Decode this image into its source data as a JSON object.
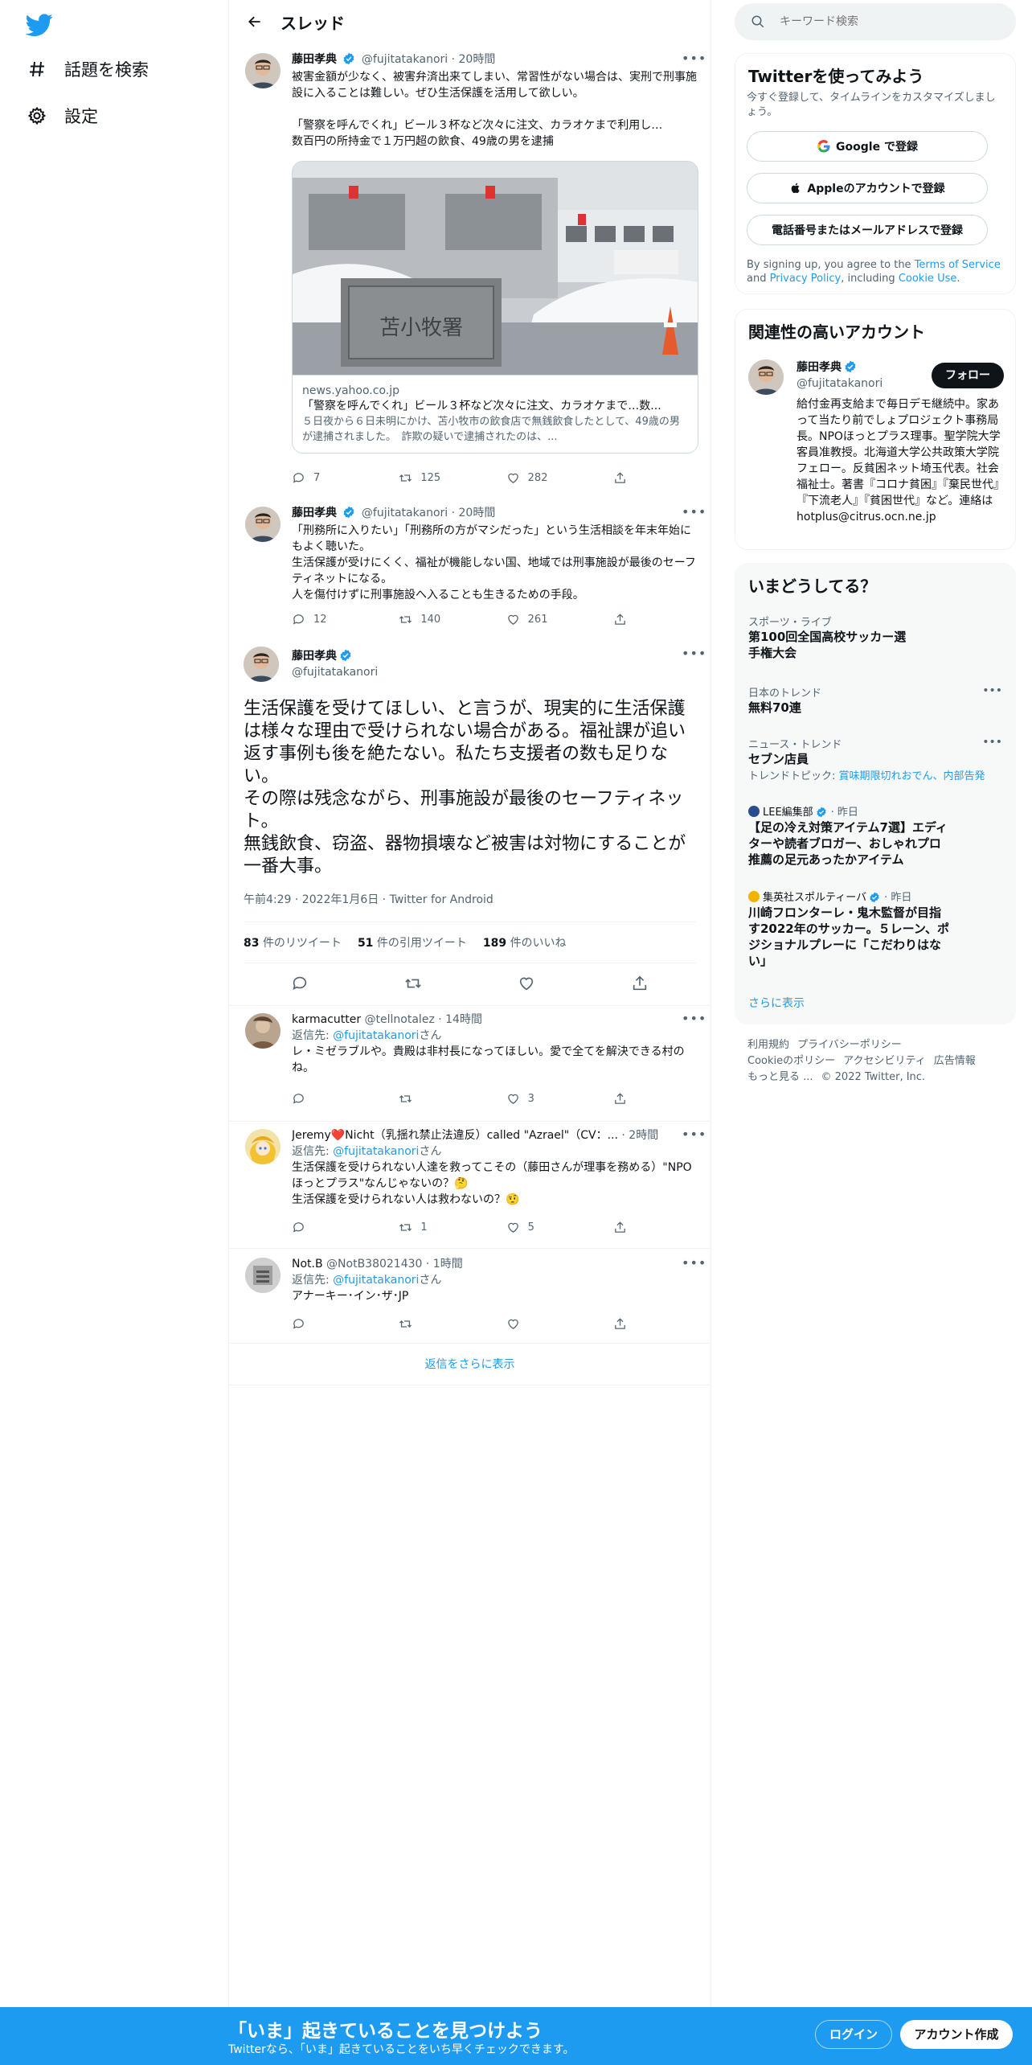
{
  "nav": {
    "items": [
      {
        "label": "話題を検索",
        "icon": "hashtag-icon"
      },
      {
        "label": "設定",
        "icon": "gear-icon"
      }
    ]
  },
  "header": {
    "title": "スレッド"
  },
  "thread": [
    {
      "name": "藤田孝典",
      "handle": "@fujitatakanori",
      "time": "· 20時間",
      "text": "被害金額が少なく、被害弁済出来てしまい、常習性がない場合は、実刑で刑事施設に入ることは難しい。ぜひ生活保護を活用して欲しい。\n\n「警察を呼んでくれ」ビール３杯など次々に注文、カラオケまで利用し…\n数百円の所持金で１万円超の飲食、49歳の男を逮捕",
      "card": {
        "domain": "news.yahoo.co.jp",
        "title": "「警察を呼んでくれ」ビール３杯など次々に注文、カラオケまで…数...",
        "desc": "５日夜から６日未明にかけ、苫小牧市の飲食店で無銭飲食したとして、49歳の男が逮捕されました。　詐欺の疑いで逮捕されたのは、..."
      },
      "replies": "7",
      "retweets": "125",
      "likes": "282"
    },
    {
      "name": "藤田孝典",
      "handle": "@fujitatakanori",
      "time": "· 20時間",
      "text": "「刑務所に入りたい」「刑務所の方がマシだった」という生活相談を年末年始にもよく聴いた。\n生活保護が受けにくく、福祉が機能しない国、地域では刑事施設が最後のセーフティネットになる。\n人を傷付けずに刑事施設へ入ることも生きるための手段。",
      "replies": "12",
      "retweets": "140",
      "likes": "261"
    }
  ],
  "main_tweet": {
    "name": "藤田孝典",
    "handle": "@fujitatakanori",
    "text": "生活保護を受けてほしい、と言うが、現実的に生活保護は様々な理由で受けられない場合がある。福祉課が追い返す事例も後を絶たない。私たち支援者の数も足りない。\nその際は残念ながら、刑事施設が最後のセーフティネット。\n無銭飲食、窃盗、器物損壊など被害は対物にすることが一番大事。",
    "meta": "午前4:29 · 2022年1月6日 · Twitter for Android",
    "retweets": "83",
    "retweets_label": "件のリツイート",
    "quotes": "51",
    "quotes_label": "件の引用ツイート",
    "likes": "189",
    "likes_label": "件のいいね"
  },
  "replies": [
    {
      "name": "karmacutter",
      "handle": "@tellnotalez",
      "time": "· 14時間",
      "replying_prefix": "返信先: ",
      "replying_to": "@fujitatakanori",
      "replying_suffix": "さん",
      "text": "レ・ミゼラブルや。貴殿は非村長になってほしい。愛で全てを解決できる村のね。",
      "replies": "",
      "retweets": "",
      "likes": "3"
    },
    {
      "name": "Jeremy❤️Nicht（乳揺れ禁止法違反）called \"Azrael\"（CV：...",
      "handle": "",
      "time": "· 2時間",
      "replying_prefix": "返信先: ",
      "replying_to": "@fujitatakanori",
      "replying_suffix": "さん",
      "text": "生活保護を受けられない人達を救ってこその（藤田さんが理事を務める）\"NPOほっとプラス\"なんじゃないの？🤔\n生活保護を受けられない人は救わないの？🤨",
      "replies": "",
      "retweets": "1",
      "likes": "5"
    },
    {
      "name": "Not.B",
      "handle": "@NotB38021430",
      "time": "· 1時間",
      "replying_prefix": "返信先: ",
      "replying_to": "@fujitatakanori",
      "replying_suffix": "さん",
      "text": "アナーキー･イン･ザ･JP",
      "replies": "",
      "retweets": "",
      "likes": ""
    }
  ],
  "more_replies": "返信をさらに表示",
  "search": {
    "placeholder": "キーワード検索"
  },
  "signup_panel": {
    "title": "Twitterを使ってみよう",
    "sub": "今すぐ登録して、タイムラインをカスタマイズしましょう。",
    "google": "Google で登録",
    "apple": "Appleのアカウントで登録",
    "phone": "電話番号またはメールアドレスで登録",
    "terms_1": "By signing up, you agree to the ",
    "terms_link1": "Terms of Service",
    "terms_2": " and ",
    "terms_link2": "Privacy Policy",
    "terms_3": ", including ",
    "terms_link3": "Cookie Use",
    "terms_4": "."
  },
  "related": {
    "title": "関連性の高いアカウント",
    "name": "藤田孝典",
    "handle": "@fujitatakanori",
    "follow": "フォロー",
    "bio": "給付金再支給まで毎日デモ継続中。家あって当たり前でしょプロジェクト事務局長。NPOほっとプラス理事。聖学院大学客員准教授。北海道大学公共政策大学院フェロー。反貧困ネット埼玉代表。社会福祉士。著書『コロナ貧困』『棄民世代』『下流老人』『貧困世代』など。連絡は hotplus@citrus.ocn.ne.jp"
  },
  "trends": {
    "title": "いまどうしてる？",
    "items": [
      {
        "category": "スポーツ・ライブ",
        "name": "第100回全国高校サッカー選手権大会"
      },
      {
        "category": "日本のトレンド",
        "name": "無料70連"
      },
      {
        "category": "ニュース・トレンド",
        "name": "セブン店員",
        "topic_prefix": "トレンドトピック: ",
        "topic": "賞味期限切れおでん、内部告発"
      },
      {
        "category": "LEE編集部",
        "time": "· 昨日",
        "name": "【足の冷え対策アイテム7選】エディターや読者ブロガー、おしゃれプロ推薦の足元あったかアイテム"
      },
      {
        "category": "集英社スポルティーバ",
        "time": "· 昨日",
        "name": "川崎フロンターレ・鬼木監督が目指す2022年のサッカー。５レーン、ポジショナルプレーに「こだわりはない」"
      }
    ],
    "show_more": "さらに表示"
  },
  "footer": {
    "links": [
      "利用規約",
      "プライバシーポリシー",
      "Cookieのポリシー",
      "アクセシビリティ",
      "広告情報",
      "もっと見る ...",
      "© 2022 Twitter, Inc."
    ]
  },
  "bottom_bar": {
    "title": "「いま」起きていることを見つけよう",
    "sub": "Twitterなら、「いま」起きていることをいち早くチェックできます。",
    "login": "ログイン",
    "signup": "アカウント作成"
  },
  "colors": {
    "accent": "#1d9bf0",
    "text": "#0f1419",
    "muted": "#536471",
    "like_red": "#f91880"
  }
}
